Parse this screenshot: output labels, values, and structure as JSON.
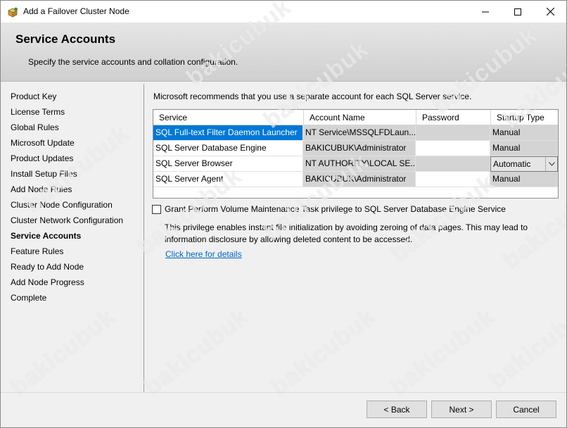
{
  "window": {
    "title": "Add a Failover Cluster Node",
    "controls": {
      "minimize": "minimize",
      "maximize": "maximize",
      "close": "close"
    }
  },
  "header": {
    "title": "Service Accounts",
    "subtitle": "Specify the service accounts and collation configuration."
  },
  "nav": {
    "items": [
      "Product Key",
      "License Terms",
      "Global Rules",
      "Microsoft Update",
      "Product Updates",
      "Install Setup Files",
      "Add Node Rules",
      "Cluster Node Configuration",
      "Cluster Network Configuration",
      "Service Accounts",
      "Feature Rules",
      "Ready to Add Node",
      "Add Node Progress",
      "Complete"
    ],
    "active_index": 9
  },
  "main": {
    "intro": "Microsoft recommends that you use a separate account for each SQL Server service.",
    "grid": {
      "columns": [
        "Service",
        "Account Name",
        "Password",
        "Startup Type"
      ],
      "rows": [
        {
          "service": "SQL Full-text Filter Daemon Launcher",
          "account": "NT Service\\MSSQLFDLaun...",
          "password": "",
          "startup": "Manual"
        },
        {
          "service": "SQL Server Database Engine",
          "account": "BAKICUBUK\\Administrator",
          "password": "",
          "startup": "Manual"
        },
        {
          "service": "SQL Server Browser",
          "account": "NT AUTHORITY\\LOCAL SE...",
          "password": "",
          "startup": "Automatic"
        },
        {
          "service": "SQL Server Agent",
          "account": "BAKICUBUK\\Administrator",
          "password": "",
          "startup": "Manual"
        }
      ]
    },
    "grant_checkbox": {
      "label": "Grant Perform Volume Maintenance Task privilege to SQL Server Database Engine Service",
      "checked": false
    },
    "privilege_note": "This privilege enables instant file initialization by avoiding zeroing of data pages. This may lead to information disclosure by allowing deleted content to be accessed.",
    "details_link": "Click here for details"
  },
  "footer": {
    "back": "< Back",
    "next": "Next >",
    "cancel": "Cancel"
  },
  "watermark": "bakicubuk",
  "colors": {
    "selection": "#0078d7",
    "link": "#0066cc"
  }
}
